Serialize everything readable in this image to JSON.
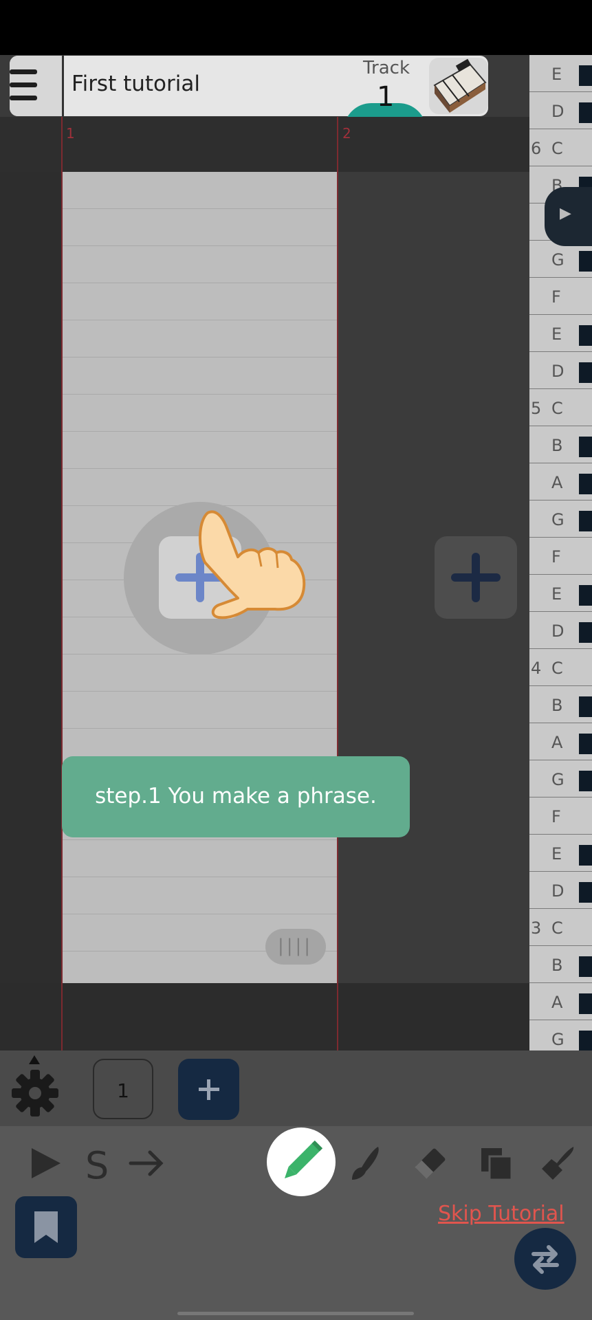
{
  "header": {
    "title": "First tutorial",
    "track_label": "Track",
    "track_number": "1"
  },
  "ruler": {
    "measures": [
      "1",
      "2"
    ]
  },
  "piano": {
    "keys": [
      {
        "note": "E",
        "octave": ""
      },
      {
        "note": "D",
        "octave": ""
      },
      {
        "note": "C",
        "octave": "6"
      },
      {
        "note": "B",
        "octave": ""
      },
      {
        "note": "A",
        "octave": ""
      },
      {
        "note": "G",
        "octave": ""
      },
      {
        "note": "F",
        "octave": ""
      },
      {
        "note": "E",
        "octave": ""
      },
      {
        "note": "D",
        "octave": ""
      },
      {
        "note": "C",
        "octave": "5"
      },
      {
        "note": "B",
        "octave": ""
      },
      {
        "note": "A",
        "octave": ""
      },
      {
        "note": "G",
        "octave": ""
      },
      {
        "note": "F",
        "octave": ""
      },
      {
        "note": "E",
        "octave": ""
      },
      {
        "note": "D",
        "octave": ""
      },
      {
        "note": "C",
        "octave": "4"
      },
      {
        "note": "B",
        "octave": ""
      },
      {
        "note": "A",
        "octave": ""
      },
      {
        "note": "G",
        "octave": ""
      },
      {
        "note": "F",
        "octave": ""
      },
      {
        "note": "E",
        "octave": ""
      },
      {
        "note": "D",
        "octave": ""
      },
      {
        "note": "C",
        "octave": "3"
      },
      {
        "note": "B",
        "octave": ""
      },
      {
        "note": "A",
        "octave": ""
      },
      {
        "note": "G",
        "octave": ""
      }
    ]
  },
  "tutorial": {
    "message": "step.1 You make a phrase.",
    "skip_label": "Skip Tutorial"
  },
  "pager": {
    "current_page": "1"
  },
  "toolbar": {
    "tools": [
      "play-icon",
      "s-icon",
      "arrow-right-icon",
      "pencil-icon",
      "brush-icon",
      "eraser-icon",
      "copy-icon",
      "paint-icon"
    ],
    "active_tool": "pencil-icon"
  },
  "colors": {
    "accent_navy": "#152942",
    "tooltip_green": "#62ac8e",
    "skip_red": "#e1554e",
    "pencil_green": "#3bb36a",
    "plus_blue": "#6c86c8"
  }
}
